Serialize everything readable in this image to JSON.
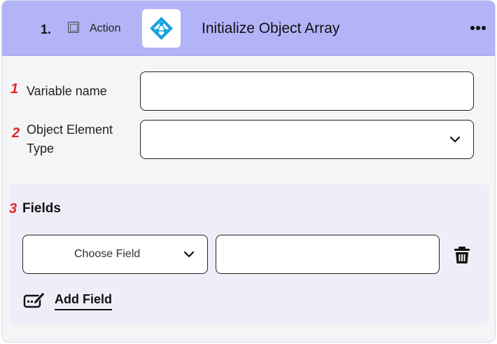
{
  "header": {
    "step_number": "1.",
    "type_label": "Action",
    "title": "Initialize Object Array",
    "app_logo_icon": "azure-ad-icon",
    "more_icon": "more-horizontal-icon",
    "background_color": "#b3b3f8"
  },
  "form": {
    "variable_name": {
      "marker": "1",
      "label": "Variable name",
      "value": ""
    },
    "object_element_type": {
      "marker": "2",
      "label_line1": "Object Element",
      "label_line2": "Type",
      "value": ""
    }
  },
  "fields_section": {
    "marker": "3",
    "title": "Fields",
    "rows": [
      {
        "choose_field_label": "Choose Field",
        "value": ""
      }
    ],
    "delete_icon": "trash-icon",
    "add_icon": "edit-add-icon",
    "add_field_label": "Add Field"
  },
  "colors": {
    "marker": "#e0262b",
    "logo_accent": "#1aa3e0"
  }
}
